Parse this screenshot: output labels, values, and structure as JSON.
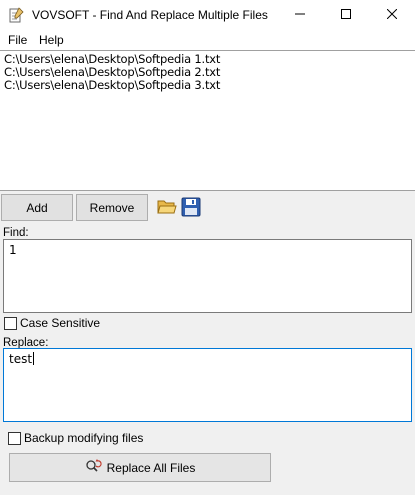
{
  "window": {
    "title": "VOVSOFT - Find And Replace Multiple Files",
    "app_icon": "notepad-icon"
  },
  "menu": {
    "file": "File",
    "help": "Help"
  },
  "file_list": {
    "items": [
      "C:\\Users\\elena\\Desktop\\Softpedia 1.txt",
      "C:\\Users\\elena\\Desktop\\Softpedia 2.txt",
      "C:\\Users\\elena\\Desktop\\Softpedia 3.txt"
    ]
  },
  "toolbar": {
    "add_label": "Add",
    "remove_label": "Remove",
    "open_icon": "folder-open-icon",
    "save_icon": "floppy-disk-icon"
  },
  "find": {
    "label": "Find:",
    "value": "1"
  },
  "case_sensitive": {
    "label": "Case Sensitive",
    "checked": false
  },
  "replace": {
    "label": "Replace:",
    "value": "test"
  },
  "backup": {
    "label": "Backup modifying files",
    "checked": false
  },
  "action": {
    "replace_all_label": "Replace All Files",
    "icon": "search-replace-icon"
  },
  "colors": {
    "focus_border": "#0078d7",
    "client_background": "#f0f0f0"
  }
}
